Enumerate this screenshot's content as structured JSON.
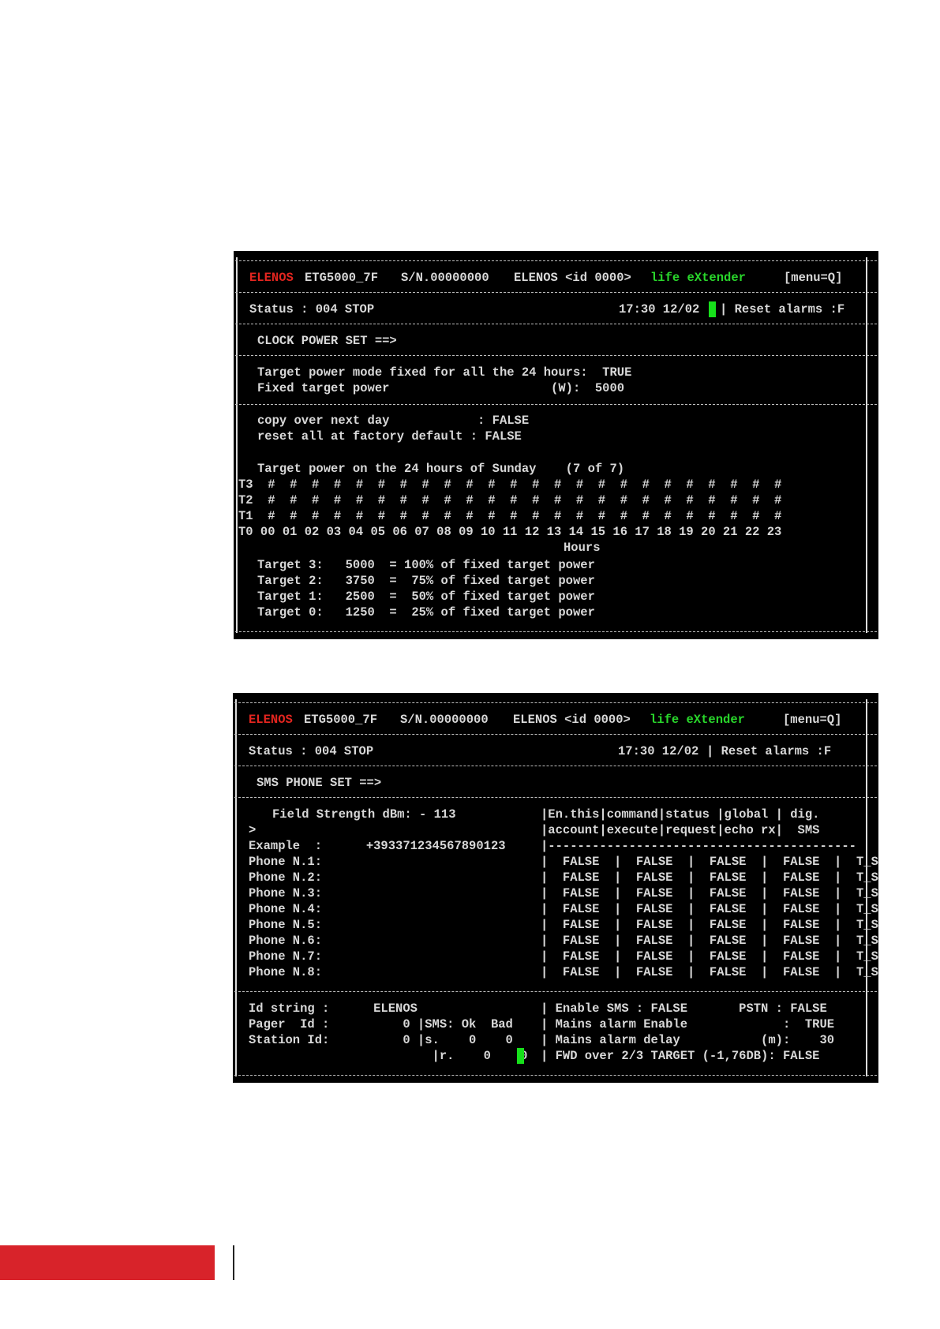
{
  "colors": {
    "brand_red": "#e3251f",
    "brand_green": "#29d62b",
    "cursor": "#17e01b",
    "page_red_bar": "#d8232a"
  },
  "screen1": {
    "header": {
      "brand": "ELENOS",
      "model": "ETG5000_7F",
      "serial": "S/N.00000000",
      "device": "ELENOS <id 0000>",
      "product": "life eXtender",
      "menu": "[menu=Q]"
    },
    "status": {
      "label": "Status : 004 STOP",
      "time": "17:30 12/02",
      "reset": "Reset alarms :F"
    },
    "section_title": "CLOCK POWER SET ==>",
    "mode_line": "Target power mode fixed for all the 24 hours:  TRUE",
    "fixed_line": "Fixed target power                      (W):  5000",
    "copy_line": "copy over next day            : FALSE",
    "reset_line": "reset all at factory default : FALSE",
    "chart_title": "Target power on the 24 hours of Sunday    (7 of 7)",
    "rows": [
      {
        "label": "T3",
        "marks": "#  #  #  #  #  #  #  #  #  #  #  #  #  #  #  #  #  #  #  #  #  #  #  #"
      },
      {
        "label": "T2",
        "marks": "#  #  #  #  #  #  #  #  #  #  #  #  #  #  #  #  #  #  #  #  #  #  #  #"
      },
      {
        "label": "T1",
        "marks": "#  #  #  #  #  #  #  #  #  #  #  #  #  #  #  #  #  #  #  #  #  #  #  #"
      },
      {
        "label": "T0",
        "marks": "00 01 02 03 04 05 06 07 08 09 10 11 12 13 14 15 16 17 18 19 20 21 22 23"
      }
    ],
    "hours_label": "Hours",
    "targets": [
      "Target 3:   5000  = 100% of fixed target power",
      "Target 2:   3750  =  75% of fixed target power",
      "Target 1:   2500  =  50% of fixed target power",
      "Target 0:   1250  =  25% of fixed target power"
    ]
  },
  "screen2": {
    "header": {
      "brand": "ELENOS",
      "model": "ETG5000_7F",
      "serial": "S/N.00000000",
      "device": "ELENOS <id 0000>",
      "product": "life eXtender",
      "menu": "[menu=Q]"
    },
    "status": {
      "label": "Status : 004 STOP",
      "time": "17:30 12/02",
      "reset": "Reset alarms :F"
    },
    "section_title": "SMS PHONE SET ==>",
    "field_strength": "Field Strength dBm: - 113",
    "col_head_1": "|En.this|command|status |global | dig.",
    "col_head_2": "|account|execute|request|echo rx|  SMS",
    "prompt": ">",
    "example": "Example  :      +393371234567890123",
    "table_rule": "|------------------------------------------",
    "phones": [
      {
        "label": "Phone N.1:",
        "row": "|  FALSE  |  FALSE  |  FALSE  |  FALSE  |  T_SMS"
      },
      {
        "label": "Phone N.2:",
        "row": "|  FALSE  |  FALSE  |  FALSE  |  FALSE  |  T_SMS"
      },
      {
        "label": "Phone N.3:",
        "row": "|  FALSE  |  FALSE  |  FALSE  |  FALSE  |  T_SMS"
      },
      {
        "label": "Phone N.4:",
        "row": "|  FALSE  |  FALSE  |  FALSE  |  FALSE  |  T_SMS"
      },
      {
        "label": "Phone N.5:",
        "row": "|  FALSE  |  FALSE  |  FALSE  |  FALSE  |  T_SMS"
      },
      {
        "label": "Phone N.6:",
        "row": "|  FALSE  |  FALSE  |  FALSE  |  FALSE  |  T_SMS"
      },
      {
        "label": "Phone N.7:",
        "row": "|  FALSE  |  FALSE  |  FALSE  |  FALSE  |  T_SMS"
      },
      {
        "label": "Phone N.8:",
        "row": "|  FALSE  |  FALSE  |  FALSE  |  FALSE  |  T_SMS"
      }
    ],
    "footer_left": [
      "Id string :      ELENOS",
      "Pager  Id :          0 |SMS: Ok  Bad",
      "Station Id:          0 |s.    0    0",
      "                         |r.    0    0"
    ],
    "footer_right": [
      "| Enable SMS : FALSE       PSTN : FALSE",
      "| Mains alarm Enable             :  TRUE",
      "| Mains alarm delay           (m):    30",
      "| FWD over 2/3 TARGET (-1,76DB): FALSE"
    ]
  }
}
